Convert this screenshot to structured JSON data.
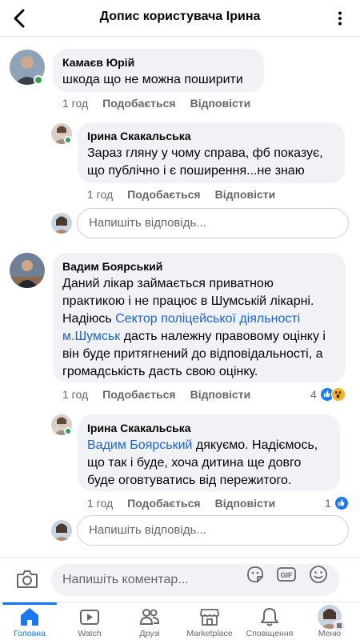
{
  "header": {
    "title": "Допис користувача Ірина"
  },
  "comments": [
    {
      "author": "Камаєв Юрій",
      "text": "шкода що не можна поширити",
      "time": "1 год",
      "like": "Подобається",
      "reply": "Відповісти"
    },
    {
      "author": "Ірина Скакальська",
      "text": "Зараз гляну у чому справа, фб показує, що публічно і є поширення...не знаю",
      "time": "1 год",
      "like": "Подобається",
      "reply": "Відповісти"
    },
    {
      "author": "Вадим Боярський",
      "text_before": "Даний лікар займається приватною практикою і не працює в Шумській лікарні. Надіюсь ",
      "mention": "Сектор поліцейської діяльності м.Шумськ",
      "text_after": " дасть належну правовому оцінку і він буде притягнений до відповідальності, а громадськість дасть свою оцінку.",
      "time": "1 год",
      "like": "Подобається",
      "reply": "Відповісти",
      "reaction_count": "4"
    },
    {
      "author": "Ірина Скакальська",
      "mention": "Вадим Боярський",
      "text_after": " дякуємо. Надіємось, що так і буде, хоча дитина ще довго буде оговтуватись від пережитого.",
      "time": "1 год",
      "like": "Подобається",
      "reply": "Відповісти",
      "reaction_count": "1"
    }
  ],
  "reply_placeholder": "Напишіть відповідь...",
  "composer": {
    "placeholder": "Напишіть коментар..."
  },
  "tabs": [
    {
      "label": "Головна",
      "icon": "home-icon",
      "active": true
    },
    {
      "label": "Watch",
      "icon": "watch-icon"
    },
    {
      "label": "Друзі",
      "icon": "friends-icon"
    },
    {
      "label": "Marketplace",
      "icon": "marketplace-icon"
    },
    {
      "label": "Сповіщення",
      "icon": "bell-icon"
    },
    {
      "label": "Меню",
      "icon": "menu-avatar"
    }
  ],
  "colors": {
    "accent": "#1877f2",
    "link": "#1c64d8",
    "bubble": "#f0f2f5",
    "muted": "#65676b",
    "online": "#31a24c"
  }
}
